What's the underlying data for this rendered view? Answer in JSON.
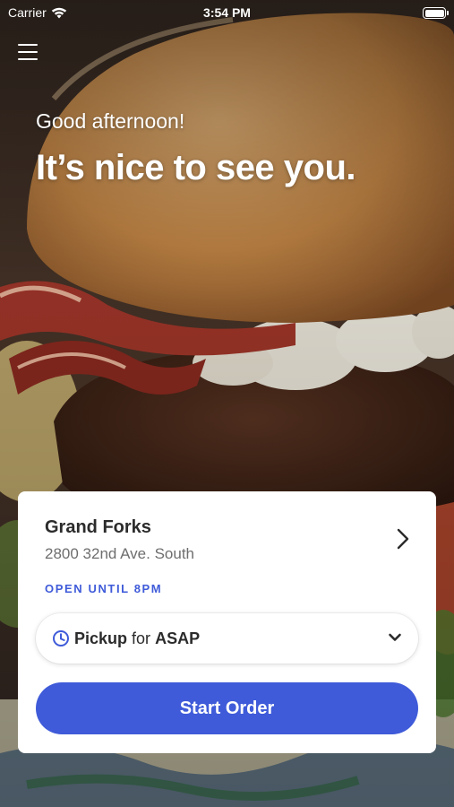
{
  "status_bar": {
    "carrier": "Carrier",
    "time": "3:54 PM"
  },
  "hero": {
    "greeting": "Good afternoon!",
    "headline": "It’s nice to see you."
  },
  "store": {
    "name": "Grand Forks",
    "address": "2800 32nd Ave. South",
    "hours": "OPEN UNTIL 8PM"
  },
  "pickup": {
    "mode": "Pickup",
    "connector": "for",
    "time": "ASAP"
  },
  "actions": {
    "start_order": "Start Order"
  },
  "icons": {
    "menu": "menu-icon",
    "wifi": "wifi-icon",
    "battery": "battery-icon",
    "store_chevron": "chevron-right-icon",
    "clock": "clock-icon",
    "dropdown": "chevron-down-icon"
  },
  "colors": {
    "accent": "#3f5bd9",
    "card": "#ffffff",
    "text_primary": "#2b2b2b",
    "text_secondary": "#6e6e6e"
  }
}
